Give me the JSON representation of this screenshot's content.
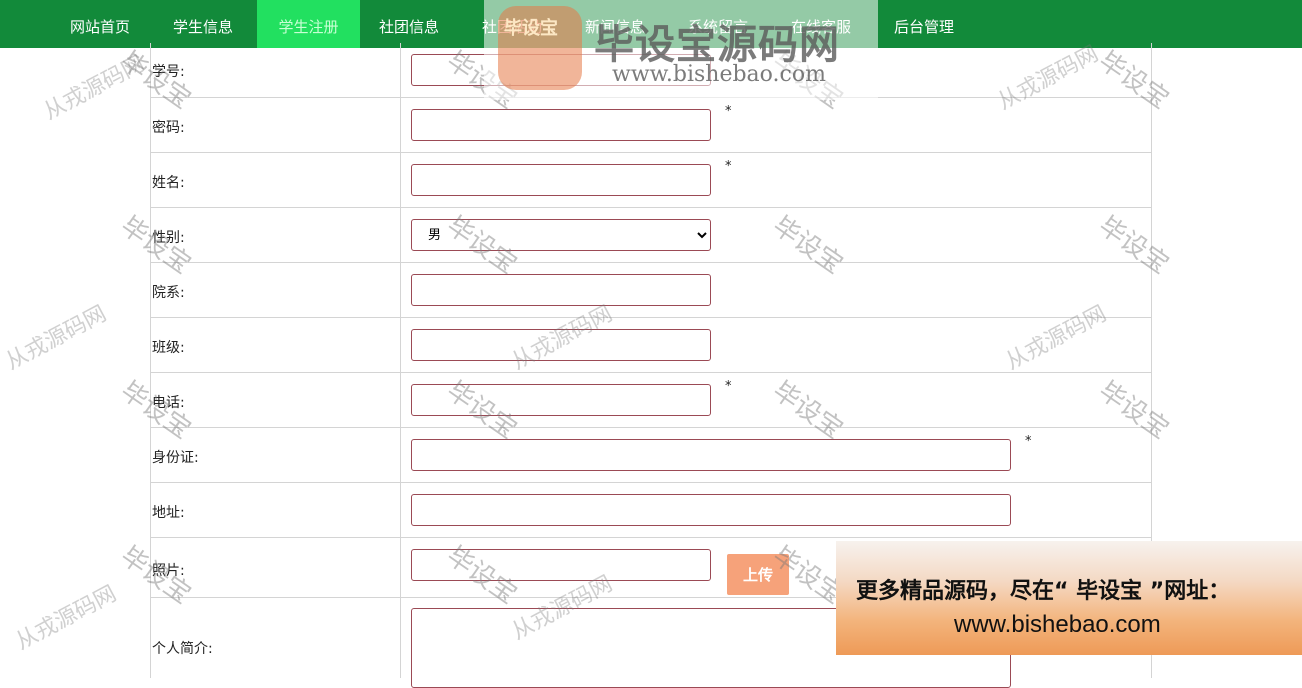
{
  "nav": {
    "items": [
      {
        "label": "网站首页",
        "active": false
      },
      {
        "label": "学生信息",
        "active": false
      },
      {
        "label": "学生注册",
        "active": true
      },
      {
        "label": "社团信息",
        "active": false
      },
      {
        "label": "社团活动",
        "active": false
      },
      {
        "label": "新闻信息",
        "active": false
      },
      {
        "label": "系统留言",
        "active": false
      },
      {
        "label": "在线客服",
        "active": false
      },
      {
        "label": "后台管理",
        "active": false
      }
    ],
    "color": "#128a3a",
    "active_color": "#22e060"
  },
  "form": {
    "fields": [
      {
        "label": "学号:",
        "value": "",
        "required": false
      },
      {
        "label": "密码:",
        "value": "",
        "required": true
      },
      {
        "label": "姓名:",
        "value": "",
        "required": true
      },
      {
        "label": "性别:",
        "value": "男",
        "required": false
      },
      {
        "label": "院系:",
        "value": "",
        "required": false
      },
      {
        "label": "班级:",
        "value": "",
        "required": false
      },
      {
        "label": "电话:",
        "value": "",
        "required": true
      },
      {
        "label": "身份证:",
        "value": "",
        "required": true
      },
      {
        "label": "地址:",
        "value": "",
        "required": false
      },
      {
        "label": "照片:",
        "value": "",
        "required": false
      },
      {
        "label": "个人简介:",
        "value": "",
        "required": false
      }
    ],
    "required_mark": "*",
    "upload_label": "上传",
    "border_color": "#9b4a55"
  },
  "watermarks": {
    "primary": "毕设宝",
    "secondary": "从戎源码网"
  },
  "logo": {
    "badge": "毕设宝",
    "title": "毕设宝源码网",
    "url": "www.bishebao.com"
  },
  "ad": {
    "line1": "更多精品源码，尽在“ 毕设宝 ”网址：",
    "line2": "www.bishebao.com"
  }
}
